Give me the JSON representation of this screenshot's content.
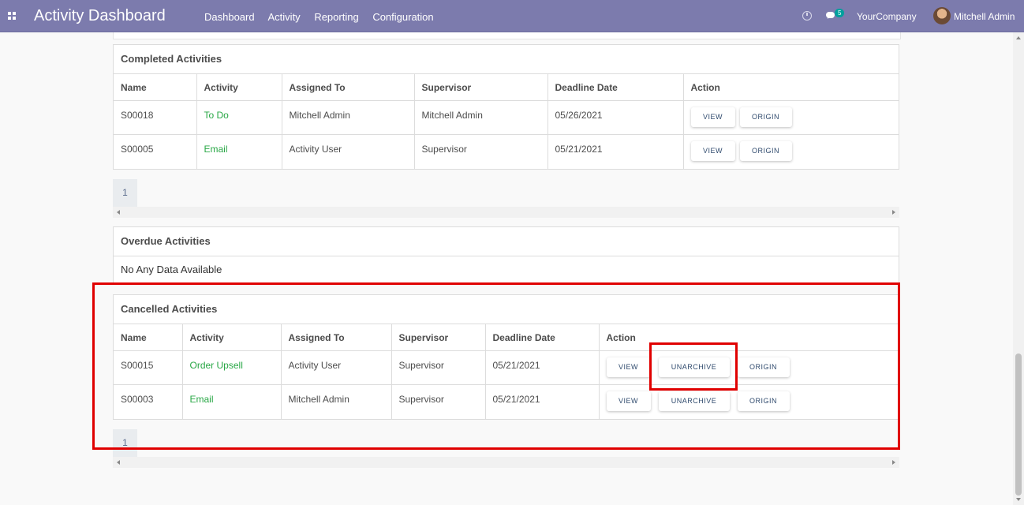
{
  "navbar": {
    "app_title": "Activity Dashboard",
    "menu": [
      "Dashboard",
      "Activity",
      "Reporting",
      "Configuration"
    ],
    "chat_badge": "5",
    "company": "YourCompany",
    "user": "Mitchell Admin"
  },
  "completed": {
    "title": "Completed Activities",
    "headers": [
      "Name",
      "Activity",
      "Assigned To",
      "Supervisor",
      "Deadline Date",
      "Action"
    ],
    "rows": [
      {
        "name": "S00018",
        "activity": "To Do",
        "assigned": "Mitchell Admin",
        "supervisor": "Mitchell Admin",
        "deadline": "05/26/2021"
      },
      {
        "name": "S00005",
        "activity": "Email",
        "assigned": "Activity User",
        "supervisor": "Supervisor",
        "deadline": "05/21/2021"
      }
    ],
    "page": "1"
  },
  "overdue": {
    "title": "Overdue Activities",
    "empty_text": "No Any Data Available"
  },
  "cancelled": {
    "title": "Cancelled Activities",
    "headers": [
      "Name",
      "Activity",
      "Assigned To",
      "Supervisor",
      "Deadline Date",
      "Action"
    ],
    "rows": [
      {
        "name": "S00015",
        "activity": "Order Upsell",
        "assigned": "Activity User",
        "supervisor": "Supervisor",
        "deadline": "05/21/2021"
      },
      {
        "name": "S00003",
        "activity": "Email",
        "assigned": "Mitchell Admin",
        "supervisor": "Supervisor",
        "deadline": "05/21/2021"
      }
    ],
    "page": "1"
  },
  "buttons": {
    "view": "VIEW",
    "origin": "ORIGIN",
    "unarchive": "UNARCHIVE"
  },
  "colors": {
    "navbar": "#7c7bad",
    "activity_text": "#28a745",
    "highlight": "#e00000"
  }
}
